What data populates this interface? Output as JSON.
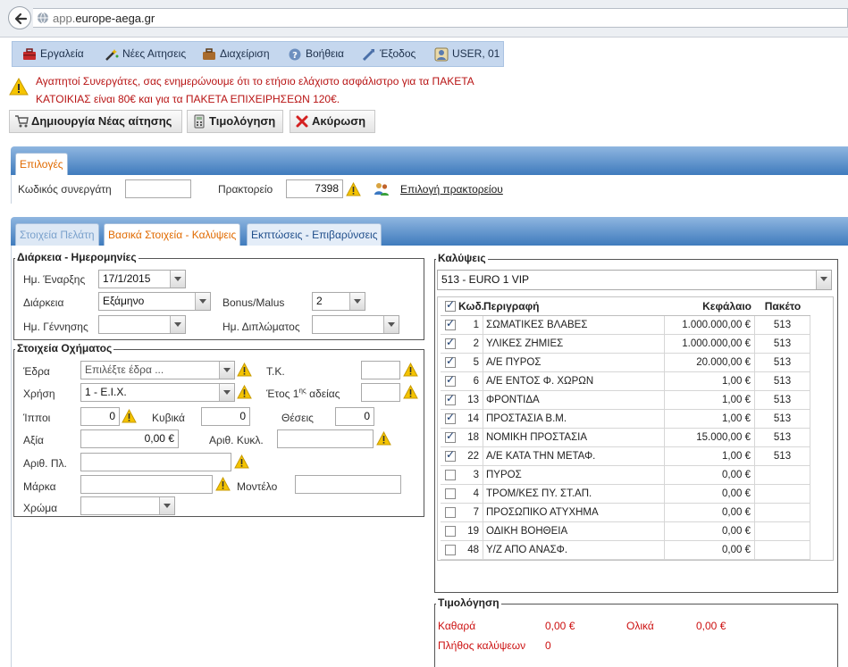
{
  "browser": {
    "url_prefix": "app.",
    "url_domain": "europe-aega.gr"
  },
  "menu": [
    {
      "label": "Εργαλεία",
      "icon": "toolbox-icon"
    },
    {
      "label": "Νέες Αιτησεις",
      "icon": "magic-wand-icon"
    },
    {
      "label": "Διαχείριση",
      "icon": "briefcase-icon"
    },
    {
      "label": "Βοήθεια",
      "icon": "help-icon"
    },
    {
      "label": "Έξοδος",
      "icon": "exit-icon"
    },
    {
      "label": "USER, 01",
      "icon": "user-icon"
    }
  ],
  "notice": {
    "line1": "Αγαπητοί Συνεργάτες, σας ενημερώνουμε ότι το ετήσιο ελάχιστο ασφάλιστρο για τα ΠΑΚΕΤΑ",
    "line2": "ΚΑΤΟΙΚΙΑΣ είναι 80€ και για τα ΠΑΚΕΤΑ ΕΠΙΧΕΙΡΗΣΕΩΝ 120€."
  },
  "actions": {
    "new_application": "Δημιουργία Νέας αίτησης",
    "invoicing": "Τιμολόγηση",
    "cancel": "Ακύρωση"
  },
  "options_panel": {
    "tab": "Επιλογές",
    "partner_code_label": "Κωδικός συνεργάτη",
    "partner_code_value": "",
    "agency_label": "Πρακτορείο",
    "agency_value": "7398",
    "select_agency_link": "Επιλογή πρακτορείου"
  },
  "tabs": {
    "customer": "Στοιχεία Πελάτη",
    "basic": "Βασικά Στοιχεία - Καλύψεις",
    "discounts": "Εκπτώσεις - Επιβαρύνσεις"
  },
  "duration": {
    "legend": "Διάρκεια - Ημερομηνίες",
    "start_label": "Ημ. Έναρξης",
    "start_value": "17/1/2015",
    "duration_label": "Διάρκεια",
    "duration_value": "Εξάμηνο",
    "bonus_label": "Bonus/Malus",
    "bonus_value": "2",
    "birth_label": "Ημ. Γέννησης",
    "birth_value": "",
    "license_label": "Ημ. Διπλώματος",
    "license_value": ""
  },
  "vehicle": {
    "legend": "Στοιχεία Οχήματος",
    "seat_label": "Έδρα",
    "seat_placeholder": "Επιλέξτε έδρα ...",
    "postcode_label": "Τ.Κ.",
    "use_label": "Χρήση",
    "use_value": "1 - Ε.Ι.Χ.",
    "year_label_pre": "Έτος 1",
    "year_label_sup": "ης",
    "year_label_post": " αδείας",
    "hp_label": "Ίπποι",
    "hp_value": "0",
    "cc_label": "Κυβικά",
    "cc_value": "0",
    "seats_label": "Θέσεις",
    "seats_value": "0",
    "value_label": "Αξία",
    "value_value": "0,00 €",
    "circulation_label": "Αριθ. Κυκλ.",
    "plate_label": "Αριθ. Πλ.",
    "brand_label": "Μάρκα",
    "model_label": "Μοντέλο",
    "color_label": "Χρώμα"
  },
  "coverages": {
    "legend": "Καλύψεις",
    "package_value": "513 - EURO 1 VIP",
    "headers": {
      "code": "Κωδ.",
      "desc": "Περιγραφή",
      "capital": "Κεφάλαιο",
      "package": "Πακέτο"
    },
    "rows": [
      {
        "checked": true,
        "code": "1",
        "desc": "ΣΩΜΑΤΙΚΕΣ ΒΛΑΒΕΣ",
        "capital": "1.000.000,00 €",
        "package": "513"
      },
      {
        "checked": true,
        "code": "2",
        "desc": "ΥΛΙΚΕΣ ΖΗΜΙΕΣ",
        "capital": "1.000.000,00 €",
        "package": "513"
      },
      {
        "checked": true,
        "code": "5",
        "desc": "Α/Ε ΠΥΡΟΣ",
        "capital": "20.000,00 €",
        "package": "513"
      },
      {
        "checked": true,
        "code": "6",
        "desc": "Α/Ε ΕΝΤΟΣ Φ. ΧΩΡΩΝ",
        "capital": "1,00 €",
        "package": "513"
      },
      {
        "checked": true,
        "code": "13",
        "desc": "ΦΡΟΝΤΙΔΑ",
        "capital": "1,00 €",
        "package": "513"
      },
      {
        "checked": true,
        "code": "14",
        "desc": "ΠΡΟΣΤΑΣΙΑ Β.Μ.",
        "capital": "1,00 €",
        "package": "513"
      },
      {
        "checked": true,
        "code": "18",
        "desc": "ΝΟΜΙΚΗ ΠΡΟΣΤΑΣΙΑ",
        "capital": "15.000,00 €",
        "package": "513"
      },
      {
        "checked": true,
        "code": "22",
        "desc": "Α/Ε ΚΑΤΑ ΤΗΝ ΜΕΤΑΦ.",
        "capital": "1,00 €",
        "package": "513"
      },
      {
        "checked": false,
        "code": "3",
        "desc": "ΠΥΡΟΣ",
        "capital": "0,00 €",
        "package": ""
      },
      {
        "checked": false,
        "code": "4",
        "desc": "ΤΡΟΜ/ΚΕΣ ΠΥ. ΣΤ.ΑΠ.",
        "capital": "0,00 €",
        "package": ""
      },
      {
        "checked": false,
        "code": "7",
        "desc": "ΠΡΟΣΩΠΙΚΟ ΑΤΥΧΗΜΑ",
        "capital": "0,00 €",
        "package": ""
      },
      {
        "checked": false,
        "code": "19",
        "desc": "ΟΔΙΚΗ ΒΟΗΘΕΙΑ",
        "capital": "0,00 €",
        "package": ""
      },
      {
        "checked": false,
        "code": "48",
        "desc": "Υ/Ζ ΑΠΟ ΑΝΑΣΦ.",
        "capital": "0,00 €",
        "package": ""
      }
    ]
  },
  "invoice": {
    "legend": "Τιμολόγηση",
    "net_label": "Καθαρά",
    "net_value": "0,00 €",
    "total_label": "Ολικά",
    "total_value": "0,00 €",
    "count_label": "Πλήθος καλύψεων",
    "count_value": "0"
  },
  "colors": {
    "accent_blue": "#3f7bbd",
    "alert_red": "#cc1111",
    "tab_orange": "#e06a00",
    "warn_yellow": "#f5c400"
  }
}
